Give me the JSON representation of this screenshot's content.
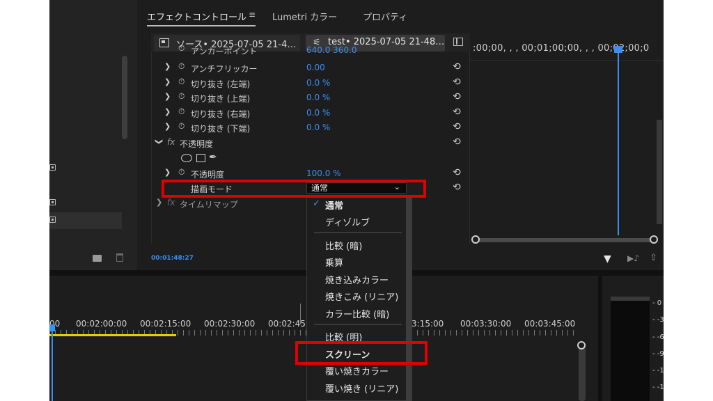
{
  "panel_tabs": {
    "effect_controls": "エフェクトコントロール",
    "menu_icon": "≡",
    "lumetri": "Lumetri カラー",
    "properties": "プロパティ"
  },
  "clip_tabs": {
    "source": "ソース• 2025-07-05 21-4…",
    "sequence": "test• 2025-07-05 21-48…"
  },
  "properties": {
    "anchor_partial_label": "アンカーポイント",
    "anchor_partial_value": "640.0   360.0",
    "rows": [
      {
        "label": "アンチフリッカー",
        "value": "0.00"
      },
      {
        "label": "切り抜き (左端)",
        "value": "0.0 %"
      },
      {
        "label": "切り抜き (上端)",
        "value": "0.0 %"
      },
      {
        "label": "切り抜き (右端)",
        "value": "0.0 %"
      },
      {
        "label": "切り抜き (下端)",
        "value": "0.0 %"
      }
    ],
    "opacity_group": "不透明度",
    "fx_symbol": "fx",
    "opacity_label": "不透明度",
    "opacity_value": "100.0 %",
    "blend_label": "描画モード",
    "blend_value": "通常",
    "time_remap": "タイムリマップ",
    "current_time": "00:01:48:27"
  },
  "mini_timeline": {
    "ruler": ":00;00, , , 00;01;00;00, , , 00;02;00;0"
  },
  "bottom_timeline": {
    "ticks": [
      "00",
      "00:02:00:00",
      "00:02:15:00",
      "00:02:30:00",
      "00:02:45:",
      "3:15:00",
      "00:03:30:00",
      "00:03:45:00"
    ]
  },
  "meter": {
    "labels": [
      "- 0",
      "- -3",
      "- -6",
      "- -9",
      "- -1",
      "- -1"
    ]
  },
  "blend_dropdown": {
    "groups": [
      [
        "通常",
        "ディゾルブ"
      ],
      [
        "比較 (暗)",
        "乗算",
        "焼き込みカラー",
        "焼きこみ (リニア)",
        "カラー比較 (暗)"
      ],
      [
        "比較 (明)",
        "スクリーン",
        "覆い焼きカラー",
        "覆い焼き (リニア)"
      ]
    ],
    "selected": "通常",
    "check": "✓"
  },
  "colors": {
    "accent_blue": "#3d8ef0",
    "highlight_red": "#e00000",
    "work_area_yellow": "#e8d000"
  }
}
